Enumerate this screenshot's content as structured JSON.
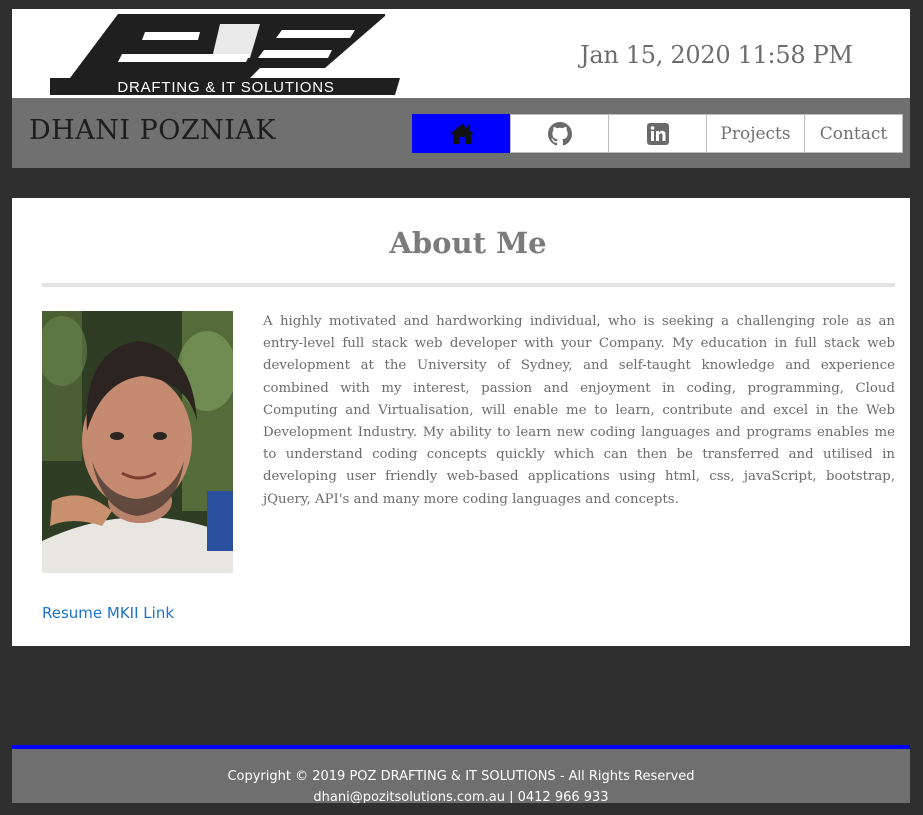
{
  "header": {
    "logo_text": "DRAFTING & IT SOLUTIONS",
    "datetime": "Jan 15, 2020 11:58 PM"
  },
  "navbar": {
    "brand": "DHANI POZNIAK",
    "items": [
      {
        "label": "",
        "icon": "home-icon",
        "active": true
      },
      {
        "label": "",
        "icon": "github-icon",
        "active": false
      },
      {
        "label": "",
        "icon": "linkedin-icon",
        "active": false
      },
      {
        "label": "Projects",
        "active": false
      },
      {
        "label": "Contact",
        "active": false
      }
    ]
  },
  "main": {
    "title": "About Me",
    "bio": "A highly motivated and hardworking individual, who is seeking a challenging role as an entry-level full stack web developer with your Company. My education in full stack web development at the University of Sydney, and self-taught knowledge and experience combined with my interest, passion and enjoyment in coding, programming, Cloud Computing and Virtualisation, will enable me to learn, contribute and excel in the Web Development Industry. My ability to learn new coding languages and programs enables me to understand coding concepts quickly which can then be transferred and utilised in developing user friendly web-based applications using html, css, javaScript, bootstrap, jQuery, API's and many more coding languages and concepts.",
    "resume_link": "Resume MKII Link"
  },
  "footer": {
    "copyright": "Copyright © 2019 POZ DRAFTING & IT SOLUTIONS - All Rights Reserved",
    "contact": "dhani@pozitsolutions.com.au | 0412 966 933"
  },
  "colors": {
    "accent": "#0000ff",
    "navbar": "#707070",
    "page_bg": "#2f2f2f",
    "link": "#1a73c8"
  }
}
